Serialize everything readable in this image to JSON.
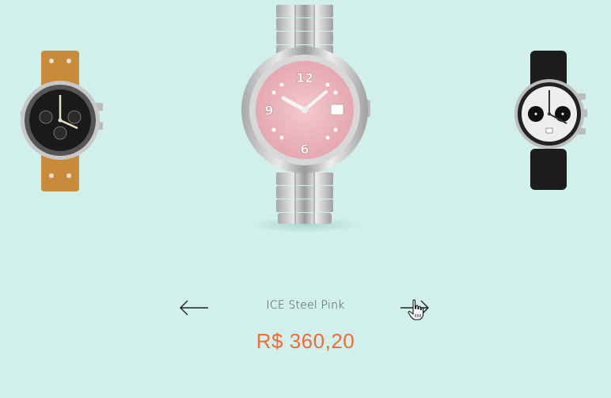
{
  "carousel": {
    "product_name": "ICE Steel Pink",
    "price": "R$ 360,20",
    "watches": {
      "left": "chronograph-brown-leather-watch",
      "center": "ice-steel-pink-watch",
      "right": "black-strap-chronograph-watch"
    },
    "prev_icon": "arrow-left-icon",
    "next_icon": "arrow-right-icon"
  },
  "colors": {
    "background": "#d2f0eb",
    "price": "#f26a35",
    "text": "#444444"
  }
}
